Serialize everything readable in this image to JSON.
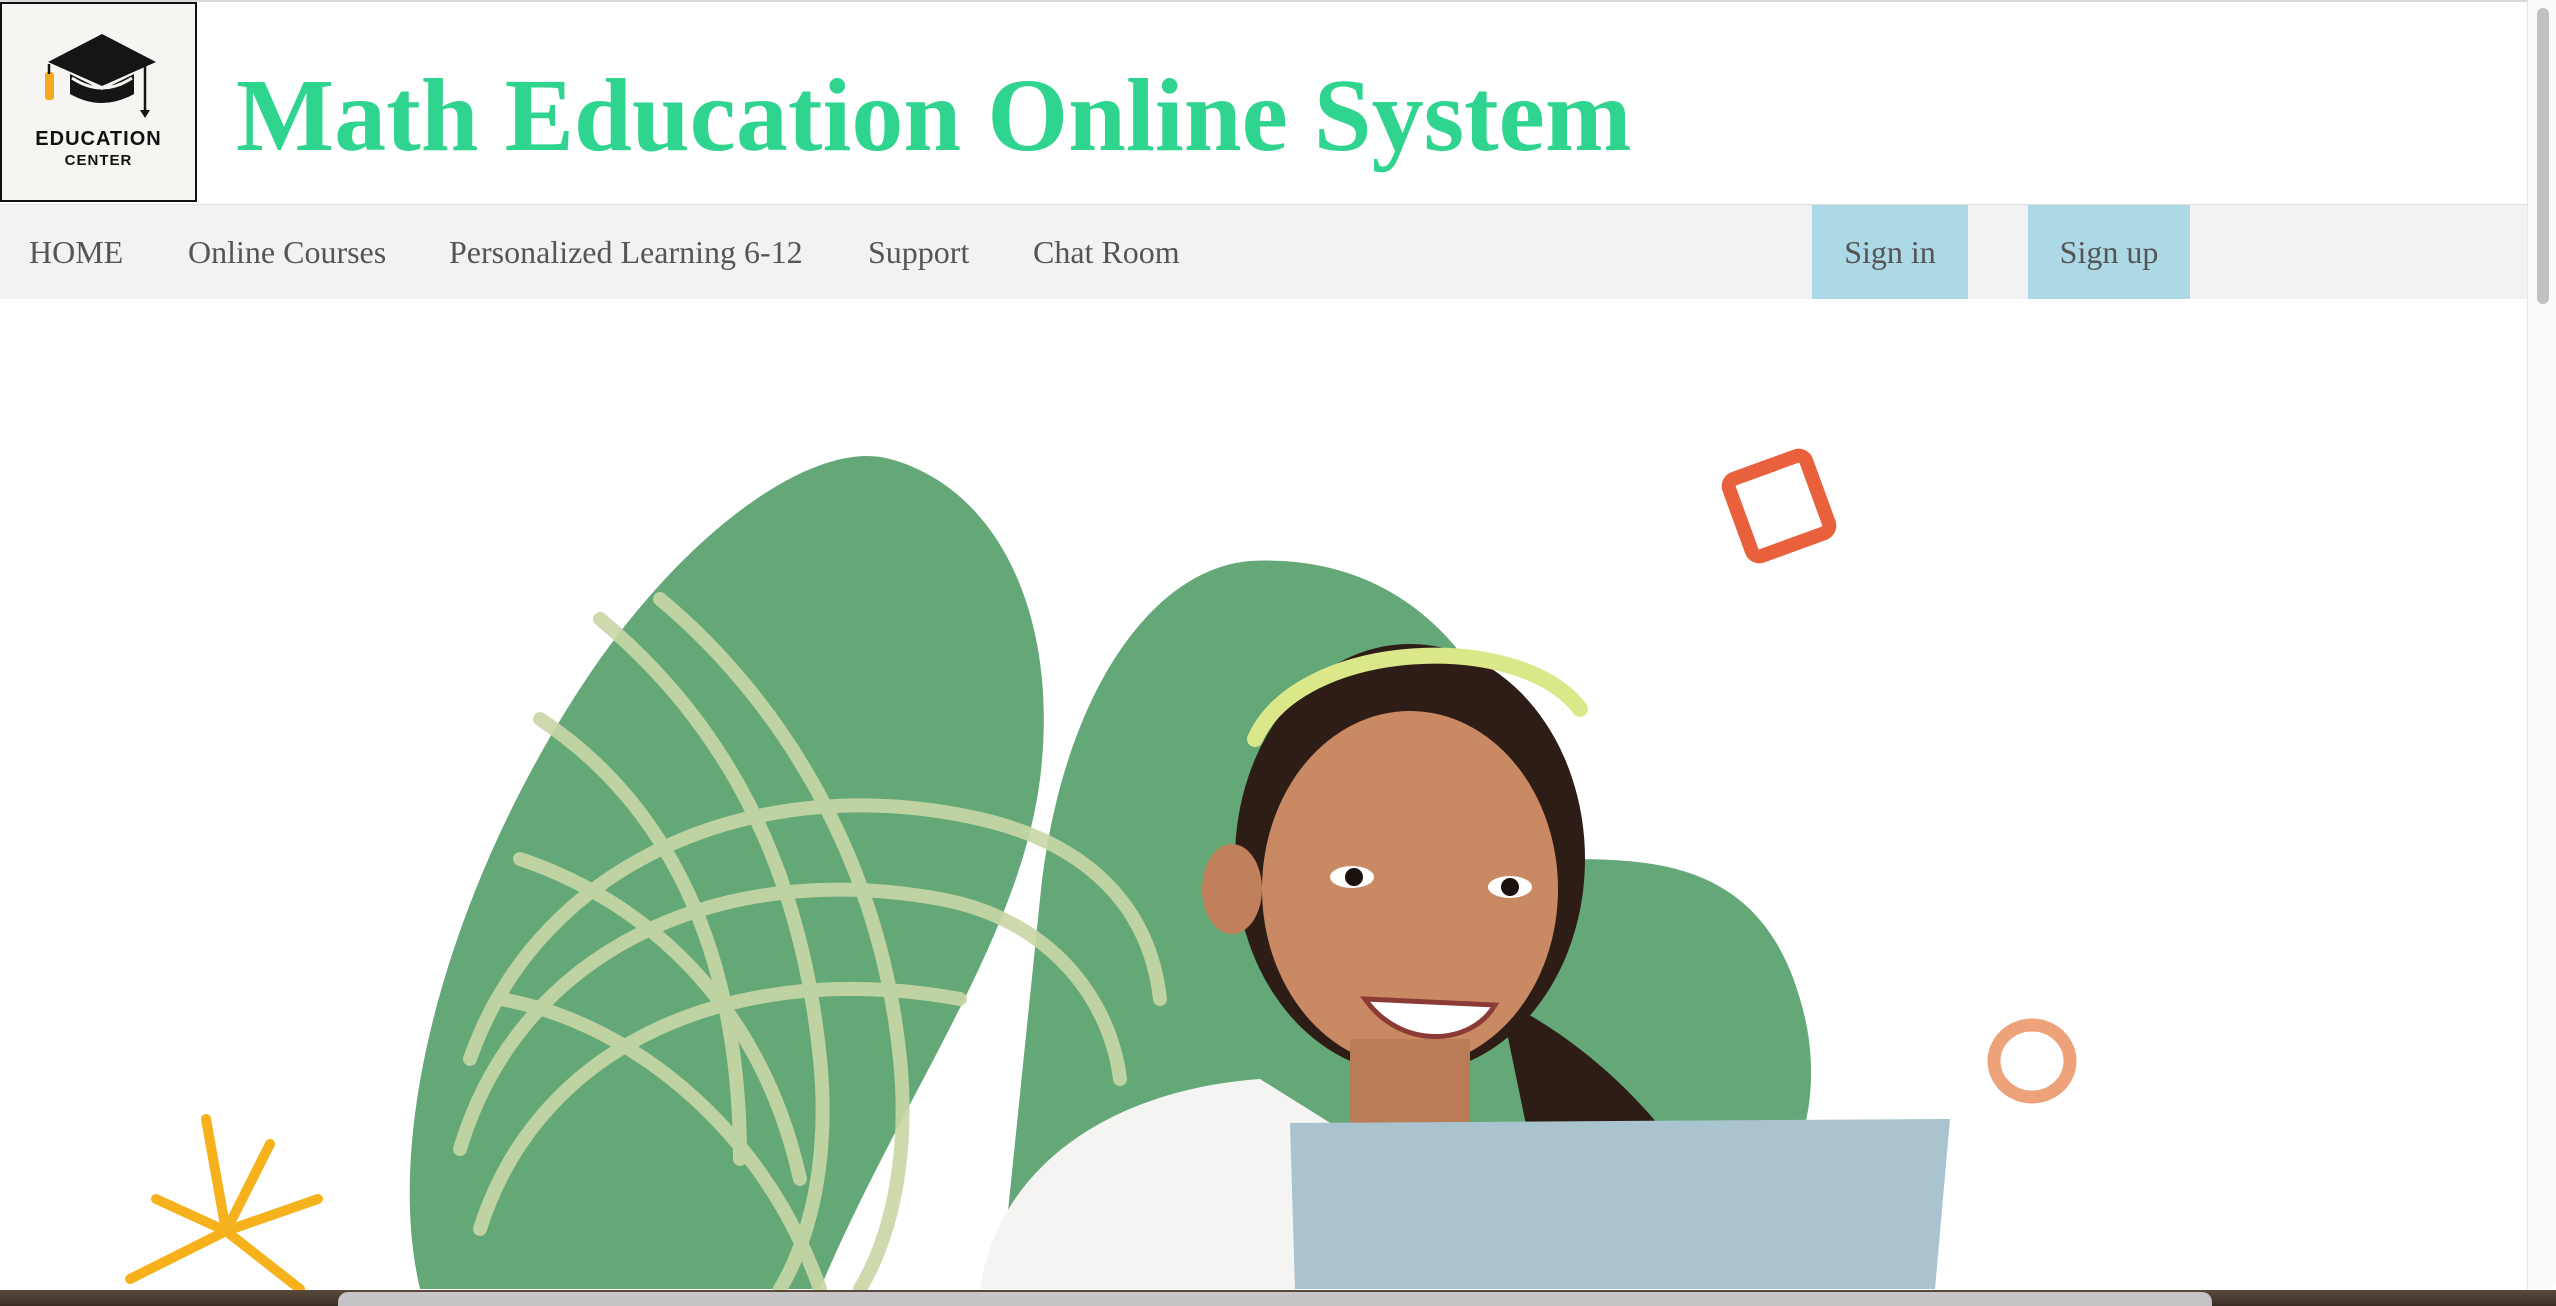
{
  "logo": {
    "line1": "EDUCATION",
    "line2": "CENTER",
    "icon": "graduation-cap-icon"
  },
  "site": {
    "title": "Math Education Online System",
    "title_color": "#2fd48f"
  },
  "nav": {
    "items": [
      {
        "label": "HOME"
      },
      {
        "label": "Online Courses"
      },
      {
        "label": "Personalized Learning 6-12"
      },
      {
        "label": "Support"
      },
      {
        "label": "Chat Room"
      }
    ],
    "sign_in": "Sign in",
    "sign_up": "Sign up",
    "button_color": "#add8e6"
  },
  "hero": {
    "image": "smiling-girl-with-laptop-illustration",
    "colors": {
      "leaf_green": "#64a878",
      "scribble": "#c9d7a6",
      "accent_orange": "#e8603c",
      "accent_peach": "#eea27a",
      "accent_yellow": "#f6b21d"
    }
  }
}
